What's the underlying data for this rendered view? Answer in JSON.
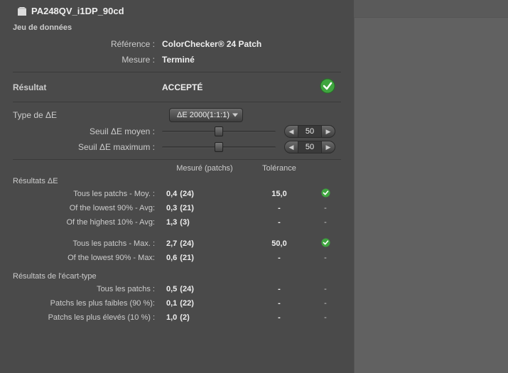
{
  "title": "PA248QV_i1DP_90cd",
  "dataset": {
    "heading": "Jeu de données",
    "reference_label": "Référence :",
    "reference_value": "ColorChecker® 24 Patch",
    "measure_label": "Mesure :",
    "measure_value": "Terminé"
  },
  "result": {
    "label": "Résultat",
    "status": "ACCEPTÉ"
  },
  "deType": {
    "label": "Type de ΔE",
    "selected": "ΔE 2000(1:1:1)"
  },
  "thresholds": {
    "mean_label": "Seuil ΔE moyen :",
    "mean_value": "50",
    "mean_pos_pct": 50,
    "max_label": "Seuil ΔE maximum :",
    "max_value": "50",
    "max_pos_pct": 50
  },
  "table": {
    "col_measured": "Mesuré (patchs)",
    "col_tolerance": "Tolérance",
    "section_de": "Résultats ΔE",
    "section_std": "Résultats de l'écart-type"
  },
  "rows_de": [
    {
      "label": "Tous les patchs - Moy. :",
      "measured": "0,4",
      "count": "(24)",
      "tolerance": "15,0",
      "pass": true
    },
    {
      "label": "Of the lowest 90% - Avg:",
      "measured": "0,3",
      "count": "(21)",
      "tolerance": "-",
      "pass": null
    },
    {
      "label": "Of the highest 10% - Avg:",
      "measured": "1,3",
      "count": "(3)",
      "tolerance": "-",
      "pass": null
    },
    {
      "label": "Tous les patchs - Max. :",
      "measured": "2,7",
      "count": "(24)",
      "tolerance": "50,0",
      "pass": true
    },
    {
      "label": "Of the lowest 90% - Max:",
      "measured": "0,6",
      "count": "(21)",
      "tolerance": "-",
      "pass": null
    }
  ],
  "rows_std": [
    {
      "label": "Tous les patchs :",
      "measured": "0,5",
      "count": "(24)",
      "tolerance": "-",
      "pass": null
    },
    {
      "label": "Patchs les plus faibles (90 %):",
      "measured": "0,1",
      "count": "(22)",
      "tolerance": "-",
      "pass": null
    },
    {
      "label": "Patchs les plus élevés (10 %) :",
      "measured": "1,0",
      "count": "(2)",
      "tolerance": "-",
      "pass": null
    }
  ]
}
